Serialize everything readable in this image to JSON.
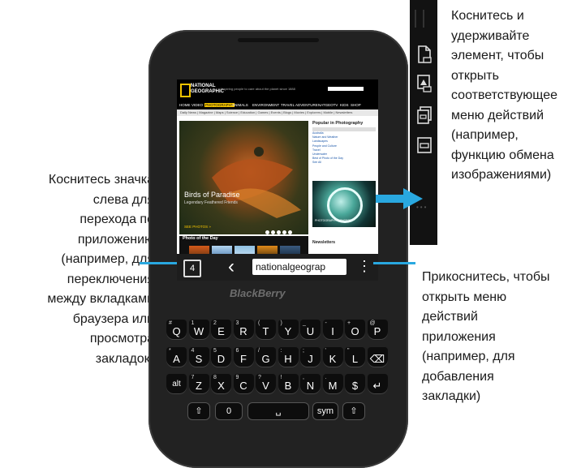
{
  "callouts": {
    "left": [
      "Коснитесь значка",
      "слева для",
      "перехода по",
      "приложению",
      "(например, для",
      "переключения",
      "между вкладками",
      "браузера или",
      "просмотра",
      "закладок)"
    ],
    "right_bottom": [
      "Прикоснитесь, чтобы",
      "открыть меню",
      "действий",
      "приложения",
      "(например, для",
      "добавления",
      "закладки)"
    ],
    "right_top": [
      "Коснитесь и",
      "удерживайте",
      "элемент, чтобы",
      "открыть",
      "соответствующее",
      "меню действий",
      "(например,",
      "функцию обмена",
      "изображениями)"
    ]
  },
  "browser": {
    "url_text": "nationalgeograp",
    "tabs_count": "4",
    "back_icon": "chevron-left-icon",
    "menu_icon": "vertical-ellipsis-icon"
  },
  "website": {
    "logo_line1": "NATIONAL",
    "logo_line2": "GEOGRAPHIC",
    "tagline": "Inspiring people to care about the planet since 1888",
    "nav_items": [
      "HOME",
      "VIDEO",
      "PHOTOGRAPHY",
      "ANIMALS",
      "ENVIRONMENT",
      "TRAVEL",
      "ADVENTURE",
      "NATGEOTV",
      "KIDS",
      "SHOP"
    ],
    "subnav": "Daily News | Magazine | Maps | Science | Education | Games | Events | Blogs | Movies | Explorers | Mobile | Newsletters",
    "hero_title": "Birds of Paradise",
    "hero_subtitle": "Legendary Feathered Friends",
    "hero_button": "SEE PHOTOS »",
    "sidebar_heading": "Popular in Photography",
    "sidebar_links": [
      "Australia",
      "Nature and Weather",
      "Landscapes",
      "People and Culture",
      "Travel",
      "Underwater",
      "Best of Photo of the Day",
      "See All"
    ],
    "ad_text": "PHOTOGRAPHY CONTEST",
    "potd_heading": "Photo of the Day",
    "newsletters_heading": "Newsletters"
  },
  "device": {
    "brand": "BlackBerry",
    "keyboard_rows": [
      [
        [
          "#",
          "Q"
        ],
        [
          "1",
          "W"
        ],
        [
          "2",
          "E"
        ],
        [
          "3",
          "R"
        ],
        [
          "(",
          "T"
        ],
        [
          ")",
          "Y"
        ],
        [
          "_",
          "U"
        ],
        [
          "-",
          "I"
        ],
        [
          "+",
          "O"
        ],
        [
          "@",
          "P"
        ]
      ],
      [
        [
          "*",
          "A"
        ],
        [
          "4",
          "S"
        ],
        [
          "5",
          "D"
        ],
        [
          "6",
          "F"
        ],
        [
          "/",
          "G"
        ],
        [
          ":",
          "H"
        ],
        [
          ";",
          "J"
        ],
        [
          "'",
          "K"
        ],
        [
          "\"",
          "L"
        ],
        [
          "",
          "⌫"
        ]
      ],
      [
        [
          "",
          "alt"
        ],
        [
          "7",
          "Z"
        ],
        [
          "8",
          "X"
        ],
        [
          "9",
          "C"
        ],
        [
          "?",
          "V"
        ],
        [
          "!",
          "B"
        ],
        [
          ",",
          "N"
        ],
        [
          ".",
          "M"
        ],
        [
          "",
          "$"
        ],
        [
          "",
          "↵"
        ]
      ]
    ],
    "bottom_keys": [
      "⇧",
      "0",
      "sym",
      "⇧"
    ]
  },
  "context_menu": {
    "icons": [
      "open-file-icon",
      "share-image-icon",
      "copy-link-icon",
      "share-link-icon"
    ]
  },
  "colors": {
    "callout_line": "#29a8e0",
    "ng_yellow": "#f5c400"
  }
}
